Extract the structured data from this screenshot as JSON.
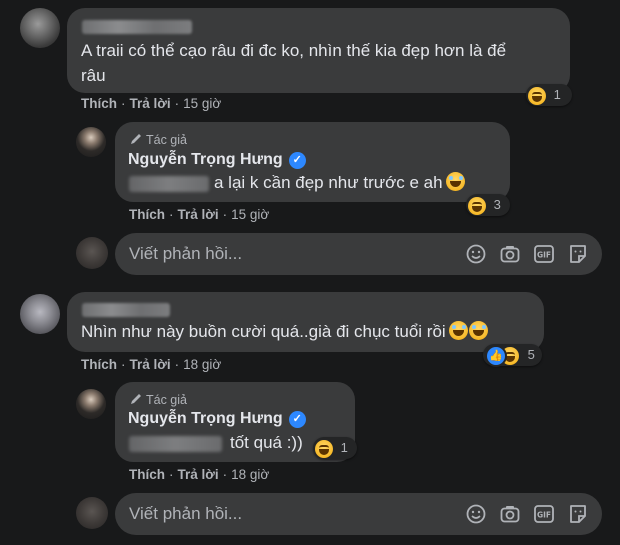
{
  "comments": [
    {
      "text_line1": "A traii có thể cạo râu đi đc ko, nhìn thế kia đẹp hơn là để",
      "text_line2": "râu",
      "like_label": "Thích",
      "reply_label": "Trả lời",
      "time": "15 giờ",
      "reaction_icon": "haha-emoji-icon",
      "reaction_count": "1",
      "reply": {
        "author_label": "Tác giả",
        "author_name": "Nguyễn Trọng Hưng",
        "text": "a lại k cần đẹp như trước e ah",
        "like_label": "Thích",
        "reply_label": "Trả lời",
        "time": "15 giờ",
        "reaction_count": "3"
      }
    },
    {
      "text_line1": "Nhìn như này buồn cười quá..già đi chục tuổi rồi",
      "like_label": "Thích",
      "reply_label": "Trả lời",
      "time": "18 giờ",
      "reaction_count": "5",
      "reply": {
        "author_label": "Tác giả",
        "author_name": "Nguyễn Trọng Hưng",
        "text": "tốt quá :))",
        "like_label": "Thích",
        "reply_label": "Trả lời",
        "time": "18 giờ",
        "reaction_count": "1"
      }
    }
  ],
  "reply_box": {
    "placeholder": "Viết phản hồi..."
  },
  "colors": {
    "background": "#18191a",
    "bubble": "#3a3b3c",
    "text": "#e4e6eb",
    "secondary_text": "#b0b3b8",
    "verified": "#2d88ff"
  }
}
